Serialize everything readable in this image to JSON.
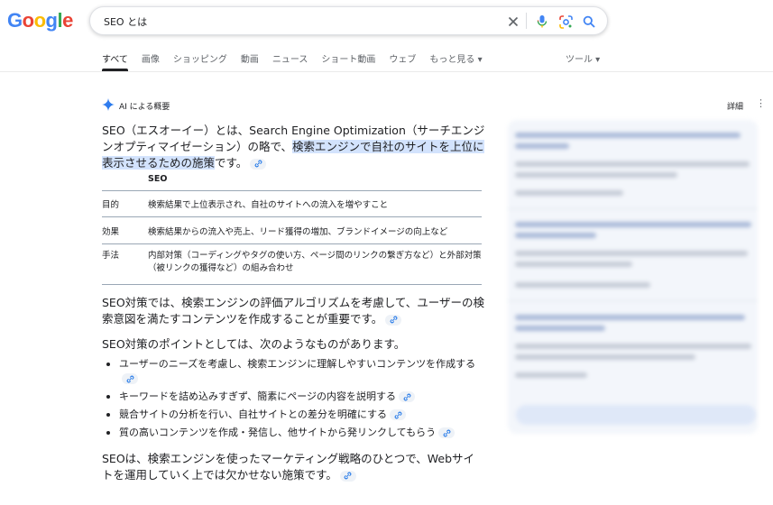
{
  "logo": {
    "text": "Google"
  },
  "search": {
    "query": "SEO とは"
  },
  "tabs": [
    {
      "label": "すべて"
    },
    {
      "label": "画像"
    },
    {
      "label": "ショッピング"
    },
    {
      "label": "動画"
    },
    {
      "label": "ニュース"
    },
    {
      "label": "ショート動画"
    },
    {
      "label": "ウェブ"
    },
    {
      "label": "もっと見る ▾"
    }
  ],
  "tools_label": "ツール ▾",
  "ai_overview": {
    "label": "AI による概要",
    "detail_label": "詳細",
    "intro": {
      "before": "SEO（エスオーイー）とは、Search Engine Optimization（サーチエンジンオプティマイゼーション）の略で、",
      "highlight": "検索エンジンで自社のサイトを上位に表示させるための施策",
      "after": "です。"
    },
    "table": {
      "header": "SEO",
      "rows": [
        {
          "label": "目的",
          "value": "検索結果で上位表示され、自社のサイトへの流入を増やすこと"
        },
        {
          "label": "効果",
          "value": "検索結果からの流入や売上、リード獲得の増加、ブランドイメージの向上など"
        },
        {
          "label": "手法",
          "value": "内部対策（コーディングやタグの使い方、ページ間のリンクの繋ぎ方など）と外部対策（被リンクの獲得など）の組み合わせ"
        }
      ]
    },
    "para2": "SEO対策では、検索エンジンの評価アルゴリズムを考慮して、ユーザーの検索意図を満たすコンテンツを作成することが重要です。",
    "para3": "SEO対策のポイントとしては、次のようなものがあります。",
    "bullets": [
      "ユーザーのニーズを考慮し、検索エンジンに理解しやすいコンテンツを作成する",
      "キーワードを詰め込みすぎず、簡素にページの内容を説明する",
      "競合サイトの分析を行い、自社サイトとの差分を明確にする",
      "質の高いコンテンツを作成・発信し、他サイトから発リンクしてもらう"
    ],
    "para4": "SEOは、検索エンジンを使ったマーケティング戦略のひとつで、Webサイトを運用していく上では欠かせない施策です。"
  },
  "colors": {
    "accent": "#1a73e8",
    "highlight": "#d3e3fd",
    "logo": [
      "#4285f4",
      "#ea4335",
      "#fbbc05",
      "#4285f4",
      "#34a853",
      "#ea4335"
    ]
  }
}
